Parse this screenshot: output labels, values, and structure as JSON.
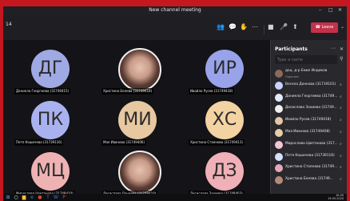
{
  "window": {
    "title": "New channel meeting"
  },
  "toolbar": {
    "timer": "14",
    "leave_label": "Leave",
    "leave_color": "#c4314b"
  },
  "tiles": [
    {
      "initials": "ДГ",
      "name": "Даниела Георгиева (31749415)",
      "color": "#9fa9e3"
    },
    {
      "photo": true,
      "name": "Христина Белева (31749418)"
    },
    {
      "initials": "ИР",
      "name": "Ивайло Русев (31749418)",
      "color": "#98a3ea"
    },
    {
      "initials": "ПК",
      "name": "Петя Кошичева (31739116)",
      "color": "#a9b2ef"
    },
    {
      "initials": "МИ",
      "name": "Мая Иванова (31749406)",
      "color": "#e7c8a0"
    },
    {
      "initials": "ХС",
      "name": "Христина Стоянова (31749413)",
      "color": "#f3d3a1"
    },
    {
      "initials": "МЦ",
      "name": "Мирослава Цветанова (31749410)",
      "color": "#efb2b3"
    },
    {
      "photo": true,
      "name": "Десислава Дончева (31749410)"
    },
    {
      "initials": "ДЗ",
      "name": "Десислава Захиева (31749403)",
      "color": "#f0b0b7"
    }
  ],
  "participants_panel": {
    "title": "Participants",
    "search_placeholder": "Type a name",
    "items": [
      {
        "name": "доц. д-р Емил Индиков",
        "sub": "Organizer",
        "color": "#8a6a5a"
      },
      {
        "name": "Весела Донкова (31719101)",
        "color": "#c9d3ff"
      },
      {
        "name": "Даниела Георгиева (31749...",
        "color": "#e6ecff"
      },
      {
        "name": "Десислава Захиева (31749...",
        "color": "#f0f0f0"
      },
      {
        "name": "Ивайло Русев (31749418)",
        "color": "#e5c8a8"
      },
      {
        "name": "Мая Иванова (31749408)",
        "color": "#e8cfa9"
      },
      {
        "name": "Мирослава Цветанова (317...",
        "color": "#f3c7d4"
      },
      {
        "name": "Петя Кошичева (31739116)",
        "color": "#d8e0ff"
      },
      {
        "name": "Христина Стоянова (31749...",
        "color": "#e8a8b8"
      },
      {
        "name": "Христина Белева (31749...",
        "color": "#b58a7a"
      }
    ]
  },
  "taskbar": {
    "time": "10:45",
    "date": "19.03.2020"
  }
}
